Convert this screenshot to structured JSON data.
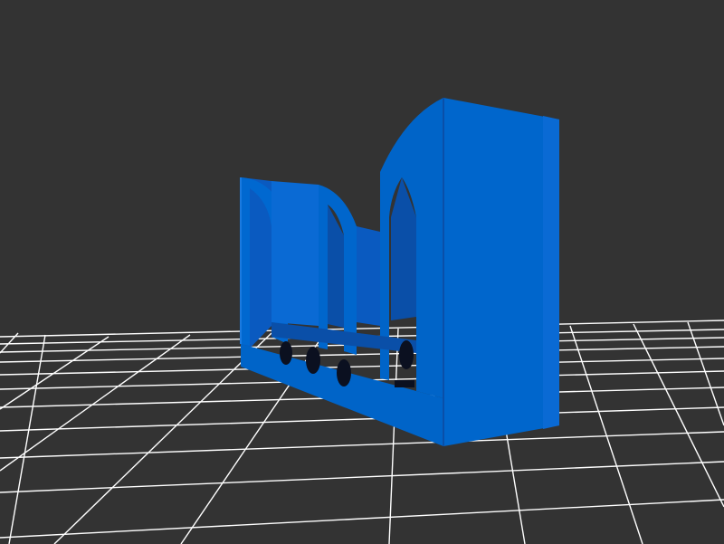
{
  "scene": {
    "background_color": "#333333",
    "grid_color": "#ffffff",
    "model_color": "#0066cc",
    "model_shadow_color": "#0a4fa8",
    "model_highlight_color": "#1a7ae0",
    "hole_color": "#0b1020"
  }
}
